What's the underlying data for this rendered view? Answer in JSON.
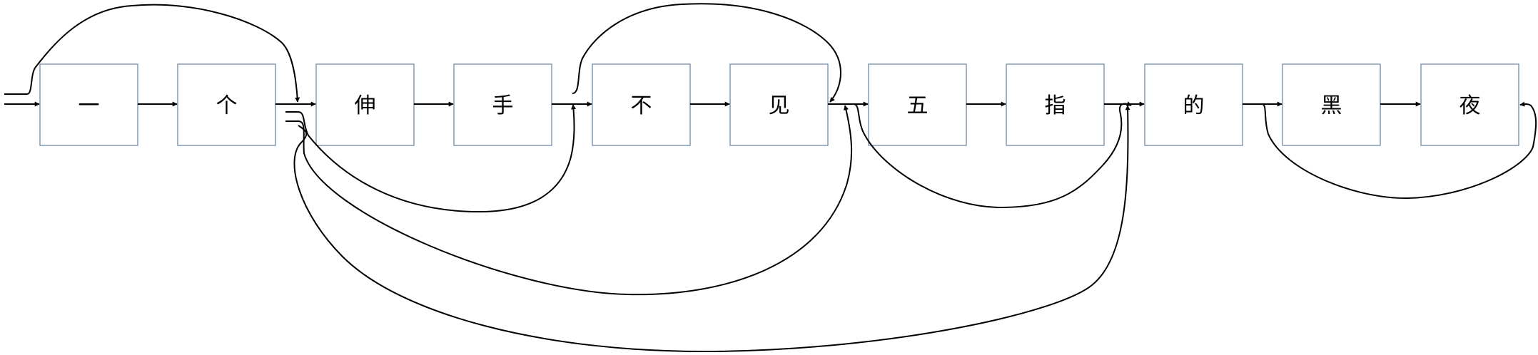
{
  "diagram": {
    "nodes": [
      {
        "id": "n0",
        "label": "一"
      },
      {
        "id": "n1",
        "label": "个"
      },
      {
        "id": "n2",
        "label": "伸"
      },
      {
        "id": "n3",
        "label": "手"
      },
      {
        "id": "n4",
        "label": "不"
      },
      {
        "id": "n5",
        "label": "见"
      },
      {
        "id": "n6",
        "label": "五"
      },
      {
        "id": "n7",
        "label": "指"
      },
      {
        "id": "n8",
        "label": "的"
      },
      {
        "id": "n9",
        "label": "黑"
      },
      {
        "id": "n10",
        "label": "夜"
      }
    ],
    "sequence_edges": [
      {
        "from": "start",
        "to": "n0"
      },
      {
        "from": "n0",
        "to": "n1"
      },
      {
        "from": "n1",
        "to": "n2"
      },
      {
        "from": "n2",
        "to": "n3"
      },
      {
        "from": "n3",
        "to": "n4"
      },
      {
        "from": "n4",
        "to": "n5"
      },
      {
        "from": "n5",
        "to": "n6"
      },
      {
        "from": "n6",
        "to": "n7"
      },
      {
        "from": "n7",
        "to": "n8"
      },
      {
        "from": "n8",
        "to": "n9"
      },
      {
        "from": "n9",
        "to": "n10"
      }
    ],
    "skip_edges": [
      {
        "from": "start",
        "to": "n2",
        "side": "above"
      },
      {
        "from": "n3",
        "to": "n5",
        "side": "above"
      },
      {
        "from": "n1",
        "to": "n4",
        "side": "below"
      },
      {
        "from": "n1",
        "to": "n6",
        "side": "below"
      },
      {
        "from": "n1",
        "to": "n8",
        "side": "below"
      },
      {
        "from": "n5",
        "to": "n8",
        "side": "below"
      },
      {
        "from": "n8",
        "to": "n10",
        "side": "below"
      }
    ],
    "colors": {
      "box_border": "#6f8aa8",
      "line": "#000000"
    }
  }
}
